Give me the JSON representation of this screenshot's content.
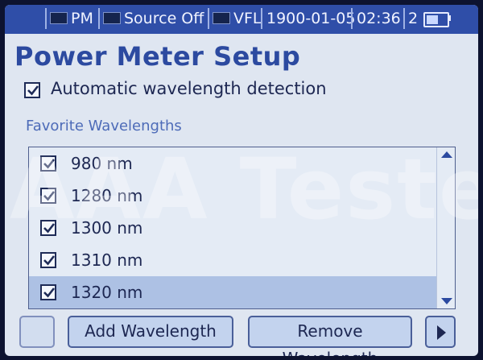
{
  "status": {
    "mode": "PM",
    "source": "Source Off",
    "vfl": "VFL",
    "date": "1900-01-05",
    "time": "02:36",
    "battery_level": "2",
    "battery_fill": 0.7
  },
  "title": "Power Meter Setup",
  "auto_detect": {
    "label": "Automatic wavelength detection",
    "checked": true
  },
  "favorites": {
    "heading": "Favorite Wavelengths",
    "items": [
      {
        "label": "980 nm",
        "checked": true
      },
      {
        "label": "1280 nm",
        "checked": true
      },
      {
        "label": "1300 nm",
        "checked": true
      },
      {
        "label": "1310 nm",
        "checked": true
      },
      {
        "label": "1320 nm",
        "checked": true,
        "selected": true
      }
    ]
  },
  "buttons": {
    "add": "Add Wavelength",
    "remove": "Remove Wavelength"
  },
  "watermark": "AAA Testers"
}
